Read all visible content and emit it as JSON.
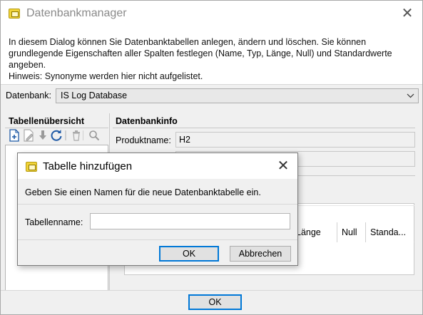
{
  "window": {
    "title": "Datenbankmanager",
    "close_glyph": "✕"
  },
  "info": {
    "text": "In diesem Dialog können Sie Datenbanktabellen anlegen, ändern und löschen. Sie können grundlegende Eigenschaften aller Spalten festlegen (Name, Typ, Länge, Null) und Standardwerte angeben.",
    "hint": "Hinweis: Synonyme werden hier nicht aufgelistet."
  },
  "database": {
    "label": "Datenbank:",
    "selected": "IS Log Database"
  },
  "left_panel": {
    "title": "Tabellenübersicht",
    "toolbar": [
      {
        "name": "new-table-icon",
        "glyph": "🗋",
        "active": true
      },
      {
        "name": "edit-table-icon",
        "glyph": "✎",
        "active": false
      },
      {
        "name": "import-icon",
        "glyph": "⬇",
        "active": false
      },
      {
        "name": "refresh-icon",
        "glyph": "⟳",
        "active": false
      },
      {
        "name": "delete-icon",
        "glyph": "🗑",
        "active": false
      },
      {
        "name": "search-icon",
        "glyph": "🔍",
        "active": false
      }
    ]
  },
  "right_panel": {
    "title": "Datenbankinfo",
    "product_label": "Produktname:",
    "product_value": "H2",
    "columns": [
      "Länge",
      "Null",
      "Standa..."
    ]
  },
  "footer": {
    "ok_label": "OK"
  },
  "dialog": {
    "title": "Tabelle hinzufügen",
    "close_glyph": "✕",
    "message": "Geben Sie einen Namen für die neue Datenbanktabelle ein.",
    "field_label": "Tabellenname:",
    "field_value": "",
    "field_placeholder": "",
    "ok_label": "OK",
    "cancel_label": "Abbrechen"
  },
  "colors": {
    "accent": "#0078d7",
    "icon_yellow": "#f1d43a",
    "title_gray": "#8a8a8a"
  }
}
